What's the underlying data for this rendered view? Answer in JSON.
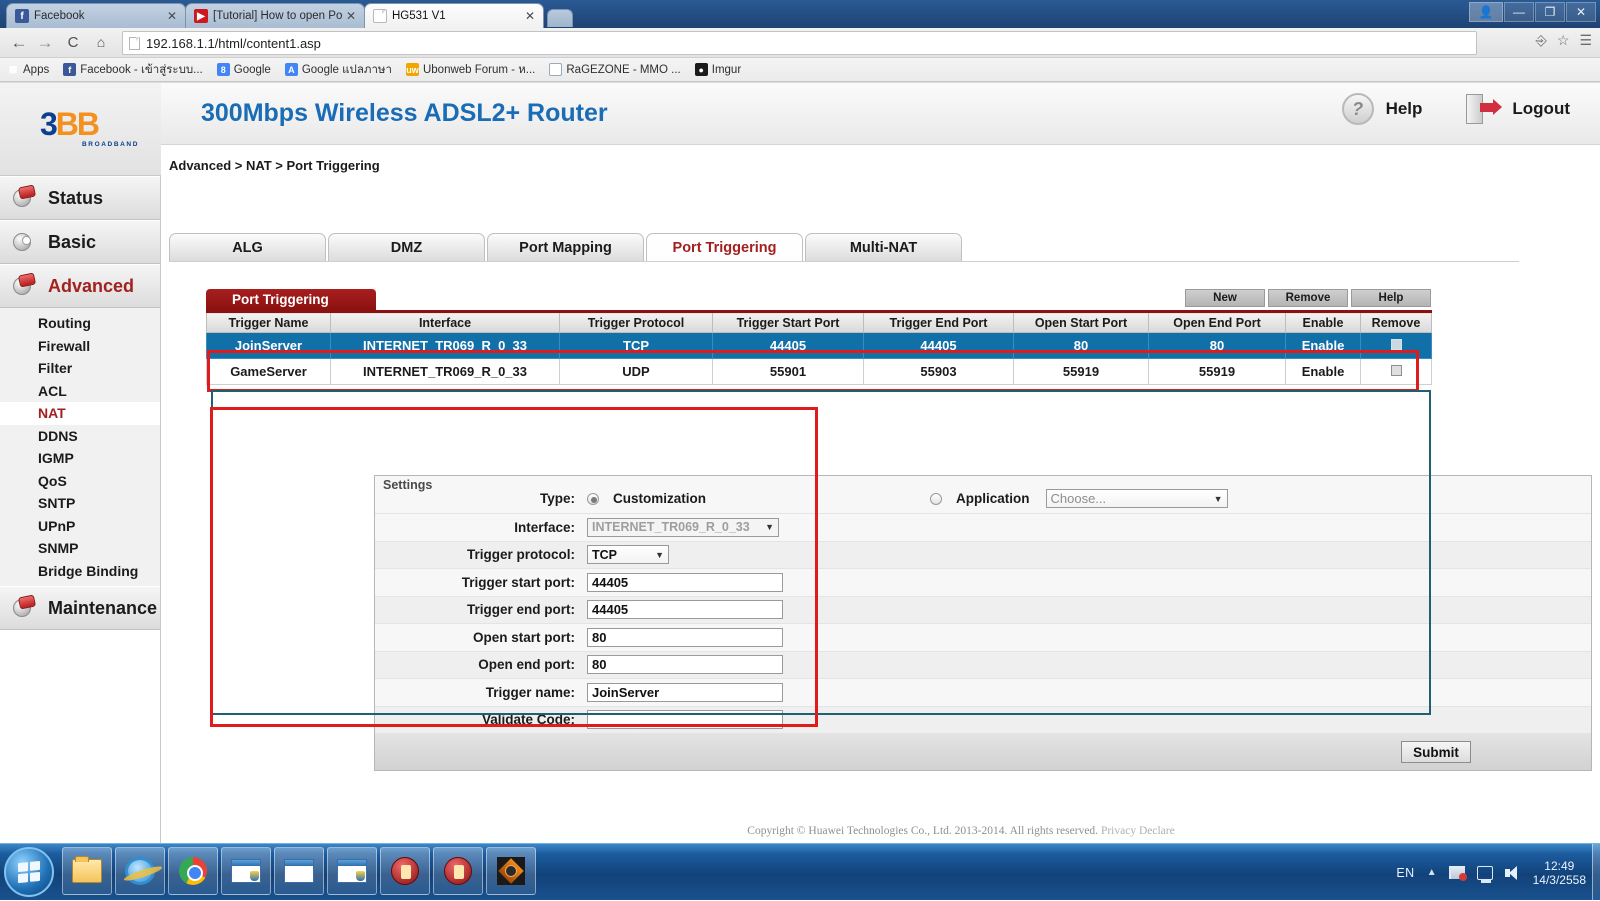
{
  "browser": {
    "tabs": [
      {
        "title": "Facebook",
        "icon": "facebook-icon",
        "active": false
      },
      {
        "title": "[Tutorial] How to open Po",
        "icon": "youtube-icon",
        "active": false
      },
      {
        "title": "HG531 V1",
        "icon": "page-icon",
        "active": true
      }
    ],
    "close_glyph": "✕",
    "nav": {
      "back": "←",
      "forward": "→",
      "reload": "C",
      "home": "⌂"
    },
    "url": "192.168.1.1/html/content1.asp",
    "toolbar_right": [
      "print-icon",
      "star-icon",
      "menu-icon"
    ],
    "window_controls": {
      "user": "user-icon",
      "minimize": "—",
      "maximize": "❐",
      "close": "✕"
    },
    "bookmarks": [
      {
        "label": "Apps",
        "icon": "apps-grid-icon"
      },
      {
        "label": "Facebook - เข้าสู่ระบบ...",
        "icon": "facebook-icon"
      },
      {
        "label": "Google",
        "icon": "google-icon"
      },
      {
        "label": "Google แปลภาษา",
        "icon": "google-translate-icon"
      },
      {
        "label": "Ubonweb Forum - ห...",
        "icon": "ubonweb-icon"
      },
      {
        "label": "RaGEZONE - MMO ...",
        "icon": "ragezone-icon"
      },
      {
        "label": "Imgur",
        "icon": "imgur-icon"
      }
    ]
  },
  "router": {
    "brand": {
      "part1": "3",
      "part2": "BB",
      "subtitle": "BROADBAND"
    },
    "header": {
      "title": "300Mbps Wireless ADSL2+ Router",
      "help_label": "Help",
      "logout_label": "Logout"
    },
    "breadcrumb": "Advanced > NAT > Port Triggering",
    "sidebar": {
      "sections": [
        {
          "label": "Status",
          "active": false
        },
        {
          "label": "Basic",
          "active": false
        },
        {
          "label": "Advanced",
          "active": true
        },
        {
          "label": "Maintenance",
          "active": false
        }
      ],
      "advanced_items": [
        {
          "label": "Routing",
          "active": false
        },
        {
          "label": "Firewall",
          "active": false
        },
        {
          "label": "Filter",
          "active": false
        },
        {
          "label": "ACL",
          "active": false
        },
        {
          "label": "NAT",
          "active": true
        },
        {
          "label": "DDNS",
          "active": false
        },
        {
          "label": "IGMP",
          "active": false
        },
        {
          "label": "QoS",
          "active": false
        },
        {
          "label": "SNTP",
          "active": false
        },
        {
          "label": "UPnP",
          "active": false
        },
        {
          "label": "SNMP",
          "active": false
        },
        {
          "label": "Bridge Binding",
          "active": false
        }
      ]
    },
    "tabs": [
      {
        "label": "ALG",
        "active": false
      },
      {
        "label": "DMZ",
        "active": false
      },
      {
        "label": "Port Mapping",
        "active": false
      },
      {
        "label": "Port Triggering",
        "active": true
      },
      {
        "label": "Multi-NAT",
        "active": false
      }
    ],
    "panel": {
      "title": "Port Triggering",
      "buttons": [
        {
          "label": "New"
        },
        {
          "label": "Remove"
        },
        {
          "label": "Help"
        }
      ],
      "columns": [
        "Trigger Name",
        "Interface",
        "Trigger Protocol",
        "Trigger Start Port",
        "Trigger End Port",
        "Open Start Port",
        "Open End Port",
        "Enable",
        "Remove"
      ],
      "rows": [
        {
          "selected": true,
          "cells": [
            "JoinServer",
            "INTERNET_TR069_R_0_33",
            "TCP",
            "44405",
            "44405",
            "80",
            "80",
            "Enable"
          ],
          "remove_checked": false
        },
        {
          "selected": false,
          "cells": [
            "GameServer",
            "INTERNET_TR069_R_0_33",
            "UDP",
            "55901",
            "55903",
            "55919",
            "55919",
            "Enable"
          ],
          "remove_checked": false
        }
      ]
    },
    "settings": {
      "title": "Settings",
      "type_label": "Type:",
      "type_customization": "Customization",
      "type_application": "Application",
      "application_select": "Choose...",
      "fields": [
        {
          "label": "Interface:",
          "value": "INTERNET_TR069_R_0_33",
          "kind": "select",
          "disabled": true
        },
        {
          "label": "Trigger protocol:",
          "value": "TCP",
          "kind": "select",
          "disabled": false
        },
        {
          "label": "Trigger start port:",
          "value": "44405",
          "kind": "text"
        },
        {
          "label": "Trigger end port:",
          "value": "44405",
          "kind": "text"
        },
        {
          "label": "Open start port:",
          "value": "80",
          "kind": "text"
        },
        {
          "label": "Open end port:",
          "value": "80",
          "kind": "text"
        },
        {
          "label": "Trigger name:",
          "value": "JoinServer",
          "kind": "text"
        },
        {
          "label": "Validate Code:",
          "value": "",
          "kind": "text"
        }
      ],
      "submit_label": "Submit",
      "caret": "▼"
    },
    "footer": {
      "text": "Copyright © Huawei Technologies Co., Ltd. 2013-2014. All rights reserved. ",
      "link": "Privacy Declare"
    },
    "accent_red": "#a32020",
    "accent_blue": "#1170a8",
    "annotation_red": "#e01b1b",
    "annotation_teal": "#1f5f6e"
  },
  "taskbar": {
    "start": "windows-start-orb",
    "items": [
      {
        "icon": "folder-explorer-icon"
      },
      {
        "icon": "internet-explorer-icon"
      },
      {
        "icon": "google-chrome-icon"
      },
      {
        "icon": "window-shield-icon"
      },
      {
        "icon": "window-icon"
      },
      {
        "icon": "window-shield-icon"
      },
      {
        "icon": "red-game-icon"
      },
      {
        "icon": "red-game-icon"
      },
      {
        "icon": "dark-game-icon"
      }
    ],
    "tray": {
      "language": "EN",
      "show_hidden": "▲",
      "icons": [
        "flag-action-center-icon",
        "network-icon",
        "volume-icon"
      ],
      "time": "12:49",
      "date": "14/3/2558"
    }
  }
}
